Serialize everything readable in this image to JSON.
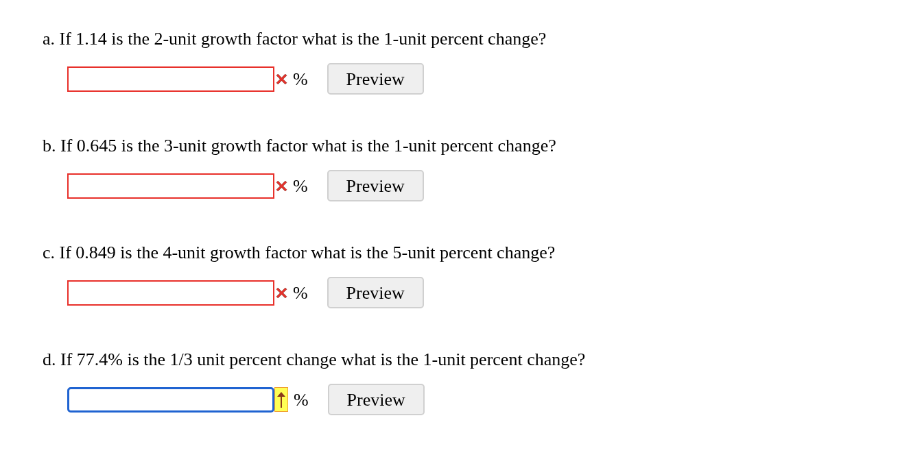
{
  "questions": [
    {
      "prompt": "a. If 1.14 is the 2-unit growth factor what is the 1-unit percent change?",
      "kind": "incorrect",
      "unit": "%",
      "button": "Preview"
    },
    {
      "prompt": "b. If 0.645 is the 3-unit growth factor what is the 1-unit percent change?",
      "kind": "incorrect",
      "unit": "%",
      "button": "Preview"
    },
    {
      "prompt": "c. If 0.849 is the 4-unit growth factor what is the 5-unit percent change?",
      "kind": "incorrect",
      "unit": "%",
      "button": "Preview"
    },
    {
      "prompt": "d. If 77.4% is the 1/3 unit percent change what is the 1-unit percent change?",
      "kind": "focused",
      "unit": "%",
      "button": "Preview"
    }
  ]
}
